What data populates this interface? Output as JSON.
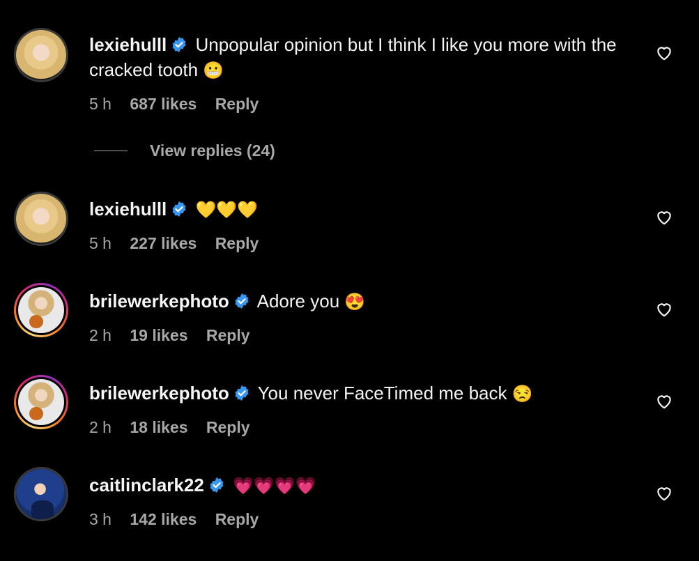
{
  "comments": [
    {
      "username": "lexiehulll",
      "text": "Unpopular opinion but I think I like you more with the cracked tooth",
      "emoji": "😬",
      "time": "5 h",
      "likes": "687 likes",
      "reply": "Reply"
    },
    {
      "username": "lexiehulll",
      "text": "",
      "emoji": "💛💛💛",
      "time": "5 h",
      "likes": "227 likes",
      "reply": "Reply"
    },
    {
      "username": "brilewerkephoto",
      "text": "Adore you",
      "emoji": "😍",
      "time": "2 h",
      "likes": "19 likes",
      "reply": "Reply"
    },
    {
      "username": "brilewerkephoto",
      "text": "You never FaceTimed me back",
      "emoji": "😒",
      "time": "2 h",
      "likes": "18 likes",
      "reply": "Reply"
    },
    {
      "username": "caitlinclark22",
      "text": "",
      "emoji": "💗💗💗💗",
      "time": "3 h",
      "likes": "142 likes",
      "reply": "Reply"
    }
  ],
  "view_replies": "View replies (24)",
  "colors": {
    "background": "#000000",
    "verified": "#3897f0",
    "meta": "#a8a8a8"
  },
  "icons": {
    "verified": "verified-badge-icon",
    "like": "heart-outline-icon"
  }
}
